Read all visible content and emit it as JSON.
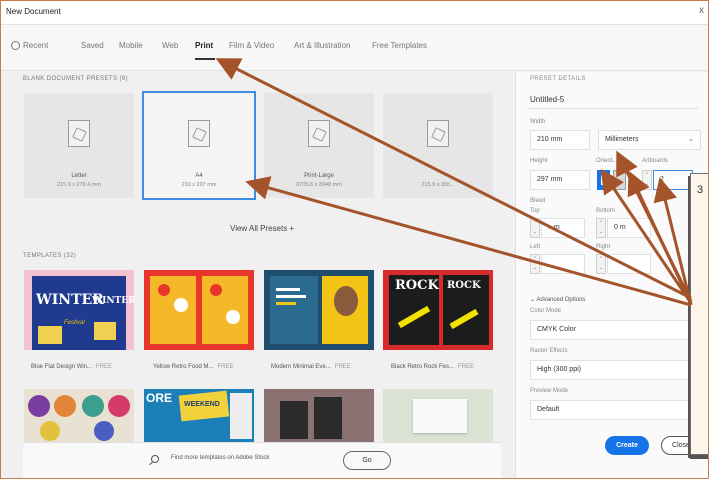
{
  "window": {
    "title": "New Document",
    "close_glyph": "x"
  },
  "tabs": [
    {
      "label": "Recent",
      "icon": "clock-icon"
    },
    {
      "label": "Saved"
    },
    {
      "label": "Mobile"
    },
    {
      "label": "Web"
    },
    {
      "label": "Print",
      "active": true
    },
    {
      "label": "Film & Video"
    },
    {
      "label": "Art & Illustration"
    },
    {
      "label": "Free Templates"
    }
  ],
  "blank_presets": {
    "heading": "BLANK DOCUMENT PRESETS (9)",
    "items": [
      {
        "name": "Letter",
        "size": "215.9 x 279.4 mm"
      },
      {
        "name": "A4",
        "size": "210 x 297 mm",
        "selected": true
      },
      {
        "name": "Print-Large",
        "size": "6705.6 x 3048 mm"
      },
      {
        "name": "",
        "size": "215.9 x 355..."
      }
    ],
    "view_all": "View All Presets +"
  },
  "templates": {
    "heading": "TEMPLATES (32)",
    "free_label": "FREE",
    "items": [
      {
        "name": "Blue Flat Design Win...",
        "poster_text_1": "WINTER",
        "poster_text_2": "WINTER",
        "poster_text_3": "Festival"
      },
      {
        "name": "Yellow Retro Food M..."
      },
      {
        "name": "Modern Minimal Eve..."
      },
      {
        "name": "Black Retro Rock Fes...",
        "poster_text_1": "ROCK",
        "poster_text_2": "ROCK"
      }
    ],
    "row2_text": {
      "ore": "ORE",
      "weekend": "WEEKEND"
    }
  },
  "stock": {
    "text": "Find more templates on Adobe Stock",
    "go_label": "Go"
  },
  "preset_details": {
    "heading": "PRESET DETAILS",
    "doc_name": "Untitled-5",
    "width_label": "Width",
    "width_value": "210 mm",
    "units": "Millimeters",
    "height_label": "Height",
    "height_value": "297 mm",
    "orientation_label": "Orient...",
    "artboards_label": "Artboards",
    "artboards_value": "2",
    "bleed_label": "Bleed",
    "top_label": "Top",
    "top_value": "...m",
    "bottom_label": "Bottom",
    "bottom_value": "0 m",
    "left_label": "Left",
    "right_label": "Right",
    "advanced_label": "Advanced Options",
    "color_mode_label": "Color Mode",
    "color_mode_value": "CMYK Color",
    "raster_label": "Raster Effects",
    "raster_value": "High (300 ppi)",
    "preview_label": "Preview Mode",
    "preview_value": "Default",
    "create_label": "Create",
    "close_label": "Close"
  },
  "callout": {
    "text": "3"
  },
  "colors": {
    "accent": "#1473e6",
    "arrow": "#a5532a",
    "selected_outline": "#3d8ee3"
  }
}
